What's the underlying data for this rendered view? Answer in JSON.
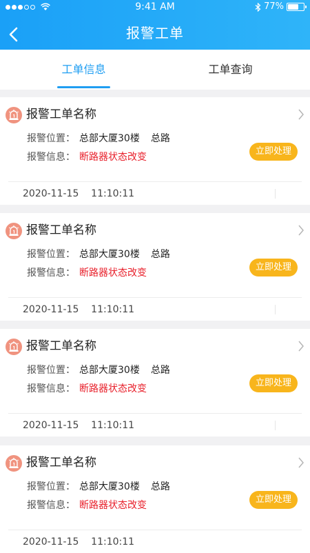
{
  "status_bar": {
    "time": "9:41 AM",
    "battery": "77%",
    "battery_level": 0.77
  },
  "nav": {
    "title": "报警工单"
  },
  "tabs": [
    {
      "label": "工单信息",
      "active": true
    },
    {
      "label": "工单查询",
      "active": false
    }
  ],
  "cards": [
    {
      "title": "报警工单名称",
      "location_label": "报警位置：",
      "location_value": "总部大厦30楼",
      "location_extra": "总路",
      "info_label": "报警信息：",
      "info_value": "断路器状态改变",
      "action_label": "立即处理",
      "time": "2020-11-15    11:10:11"
    },
    {
      "title": "报警工单名称",
      "location_label": "报警位置：",
      "location_value": "总部大厦30楼",
      "location_extra": "总路",
      "info_label": "报警信息：",
      "info_value": "断路器状态改变",
      "action_label": "立即处理",
      "time": "2020-11-15    11:10:11"
    },
    {
      "title": "报警工单名称",
      "location_label": "报警位置：",
      "location_value": "总部大厦30楼",
      "location_extra": "总路",
      "info_label": "报警信息：",
      "info_value": "断路器状态改变",
      "action_label": "立即处理",
      "time": "2020-11-15    11:10:11"
    },
    {
      "title": "报警工单名称",
      "location_label": "报警位置：",
      "location_value": "总部大厦30楼",
      "location_extra": "总路",
      "info_label": "报警信息：",
      "info_value": "断路器状态改变",
      "action_label": "立即处理",
      "time": "2020-11-15    11:10:11"
    }
  ],
  "colors": {
    "header": "#1aa0f7",
    "accent": "#1f9ef2",
    "action": "#f8b51c",
    "alarm_text": "#e8202b",
    "alarm_icon": "#f0937f"
  }
}
